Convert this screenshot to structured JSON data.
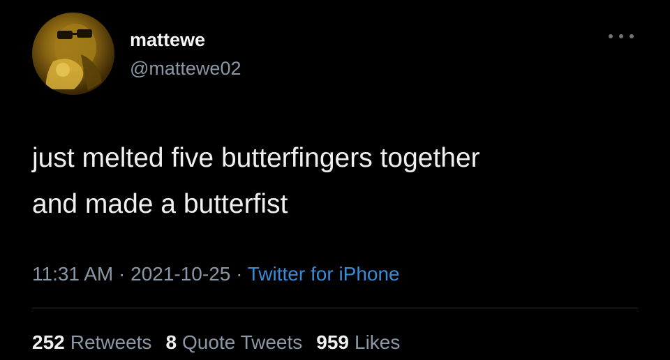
{
  "tweet": {
    "author": {
      "display_name": "mattewe",
      "handle": "@mattewe02",
      "avatar_icon": "profile-photo"
    },
    "more_icon": "more-options-icon",
    "text": "just melted five butterfingers together\nand made a butterfist",
    "meta": {
      "time": "11:31 AM",
      "separator": " · ",
      "date": "2021-10-25",
      "separator2": " · ",
      "source": "Twitter for iPhone"
    },
    "stats": {
      "retweets_count": "252",
      "retweets_label": "Retweets",
      "quotes_count": "8",
      "quotes_label": "Quote Tweets",
      "likes_count": "959",
      "likes_label": "Likes"
    }
  },
  "colors": {
    "background": "#000000",
    "primary_text": "#f0f0f0",
    "secondary_text": "#8b98a5",
    "link": "#3a8bd7",
    "divider": "#2f3336"
  }
}
